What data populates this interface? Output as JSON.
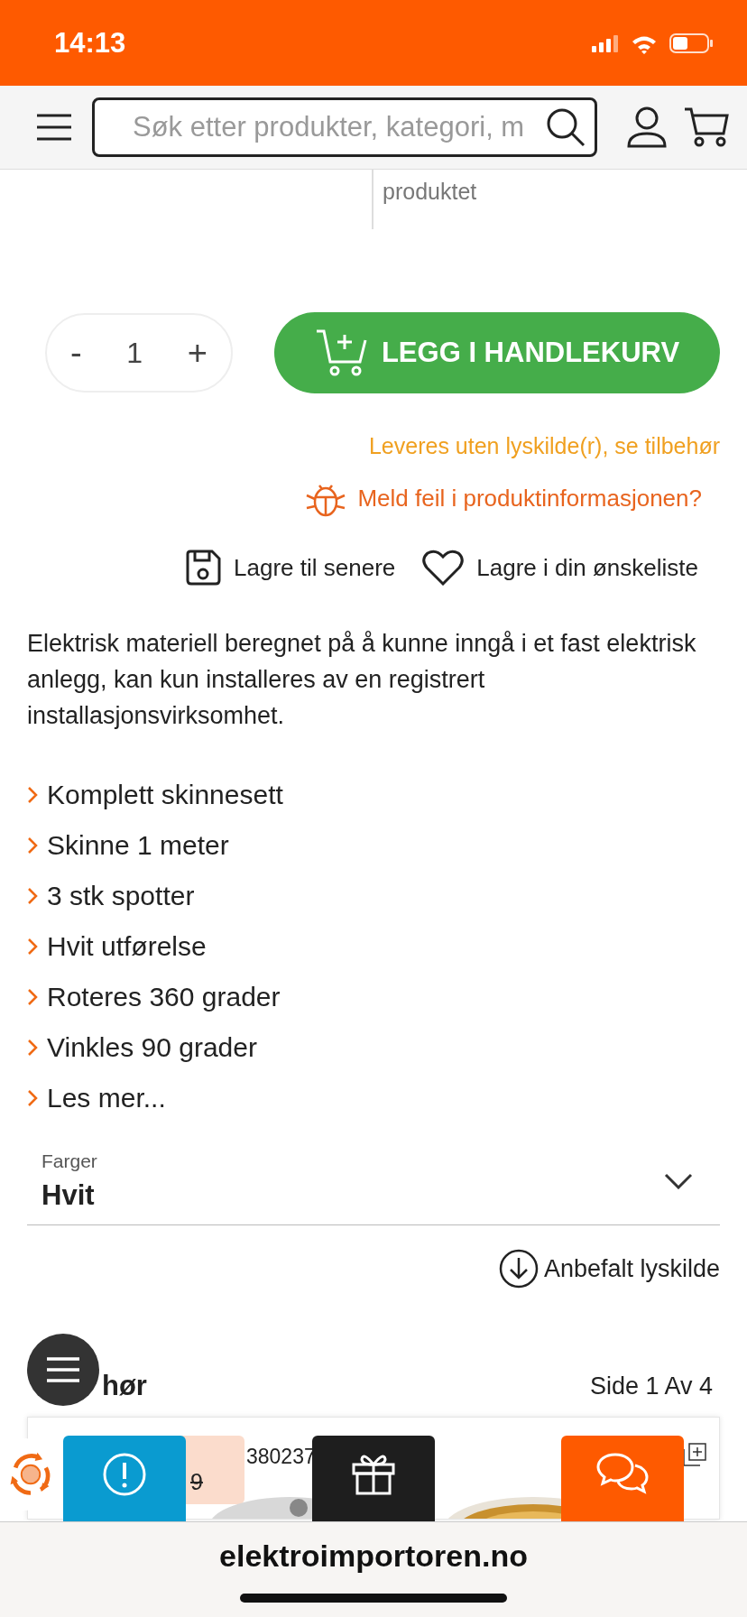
{
  "status_bar": {
    "time": "14:13"
  },
  "header": {
    "search": {
      "placeholder": "Søk etter produkter, kategori, m"
    }
  },
  "purchase_note": "produktet",
  "quantity": {
    "minus": "-",
    "value": "1",
    "plus": "+"
  },
  "add_to_cart": "LEGG I HANDLEKURV",
  "light_source_note": "Leveres uten lyskilde(r), se tilbehør",
  "report_error": "Meld feil i produktinformasjonen?",
  "save_actions": [
    {
      "kind": "later",
      "label": "Lagre til senere"
    },
    {
      "kind": "wishlist",
      "label": "Lagre i din ønskeliste"
    }
  ],
  "description": "Elektrisk materiell beregnet på å kunne inngå i et fast elektrisk anlegg, kan kun installeres av en registrert installasjonsvirksomhet.",
  "features": [
    {
      "label": "Komplett skinnesett"
    },
    {
      "label": "Skinne 1 meter"
    },
    {
      "label": "3 stk spotter"
    },
    {
      "label": "Hvit utførelse"
    },
    {
      "label": "Roteres 360 grader"
    },
    {
      "label": "Vinkles 90 grader"
    },
    {
      "label": "Les mer..."
    }
  ],
  "color_select": {
    "label": "Farger",
    "value": "Hvit"
  },
  "recommended": "Anbefalt lyskilde",
  "accessories": {
    "heading": "hør",
    "pager": "Side 1 Av  4",
    "card": {
      "number": "380237",
      "price": "9"
    }
  },
  "browser": {
    "url": "elektroimportoren.no"
  }
}
